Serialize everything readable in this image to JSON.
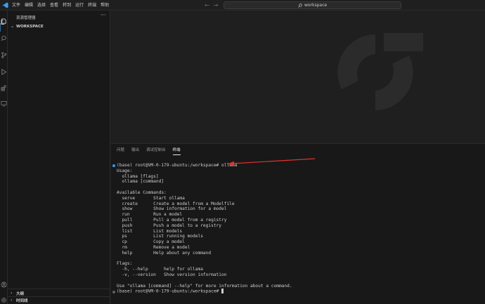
{
  "titlebar": {
    "menu": [
      "文件",
      "编辑",
      "选择",
      "查看",
      "转到",
      "运行",
      "终端",
      "帮助"
    ],
    "search_text": "workspace"
  },
  "sidebar": {
    "header": "资源管理器",
    "more": "···",
    "workspace_label": "WORKSPACE",
    "outline_label": "大纲",
    "timeline_label": "时间线"
  },
  "panel": {
    "tabs": [
      "问题",
      "输出",
      "调试控制台",
      "终端"
    ],
    "active_tab": "终端"
  },
  "terminal": {
    "lines": [
      "(base) root@VM-0-179-ubuntu:/workspace# ollama",
      "Usage:",
      "  ollama [flags]",
      "  ollama [command]",
      "",
      "Available Commands:",
      "  serve       Start ollama",
      "  create      Create a model from a Modelfile",
      "  show        Show information for a model",
      "  run         Run a model",
      "  pull        Pull a model from a registry",
      "  push        Push a model to a registry",
      "  list        List models",
      "  ps          List running models",
      "  cp          Copy a model",
      "  rm          Remove a model",
      "  help        Help about any command",
      "",
      "Flags:",
      "  -h, --help      help for ollama",
      "  -v, --version   Show version information",
      "",
      "Use \"ollama [command] --help\" for more information about a command.",
      "(base) root@VM-0-179-ubuntu:/workspace# "
    ]
  },
  "colors": {
    "accent": "#0078d4",
    "annotation_arrow": "#e0332f",
    "prompt_dot": "#3794ff"
  },
  "icons": [
    "files-icon",
    "search-icon",
    "source-control-icon",
    "run-debug-icon",
    "extensions-icon",
    "remote-explorer-icon",
    "account-icon",
    "settings-gear-icon"
  ]
}
